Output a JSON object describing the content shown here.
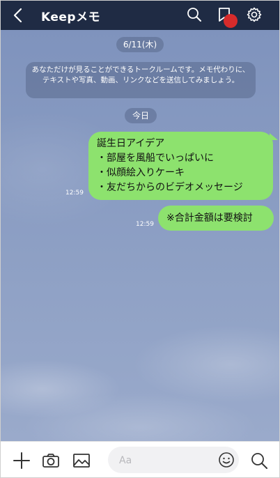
{
  "header": {
    "title": "Keepメモ",
    "icons": [
      "chevron-left-icon",
      "search-icon",
      "bookmark-icon",
      "gear-icon"
    ],
    "badge_color": "#d72b2b",
    "bg_color": "#1f2b44"
  },
  "chat": {
    "date_label": "6/11(木)",
    "system_message": "あなただけが見ることができるトークルームです。メモ代わりに、テキストや写真、動画、リンクなどを送信してみましょう。",
    "today_label": "今日",
    "messages": [
      {
        "lines": [
          "誕生日アイデア",
          "・部屋を風船でいっぱいに",
          "・似顔絵入りケーキ",
          "・友だちからのビデオメッセージ"
        ],
        "time": "12:59"
      },
      {
        "lines": [
          "※合計金額は要検討"
        ],
        "time": "12:59"
      }
    ],
    "bubble_color": "#8de26e"
  },
  "footer": {
    "placeholder": "Aa",
    "icons": [
      "plus-icon",
      "camera-icon",
      "image-icon",
      "emoji-icon",
      "search-icon"
    ]
  }
}
